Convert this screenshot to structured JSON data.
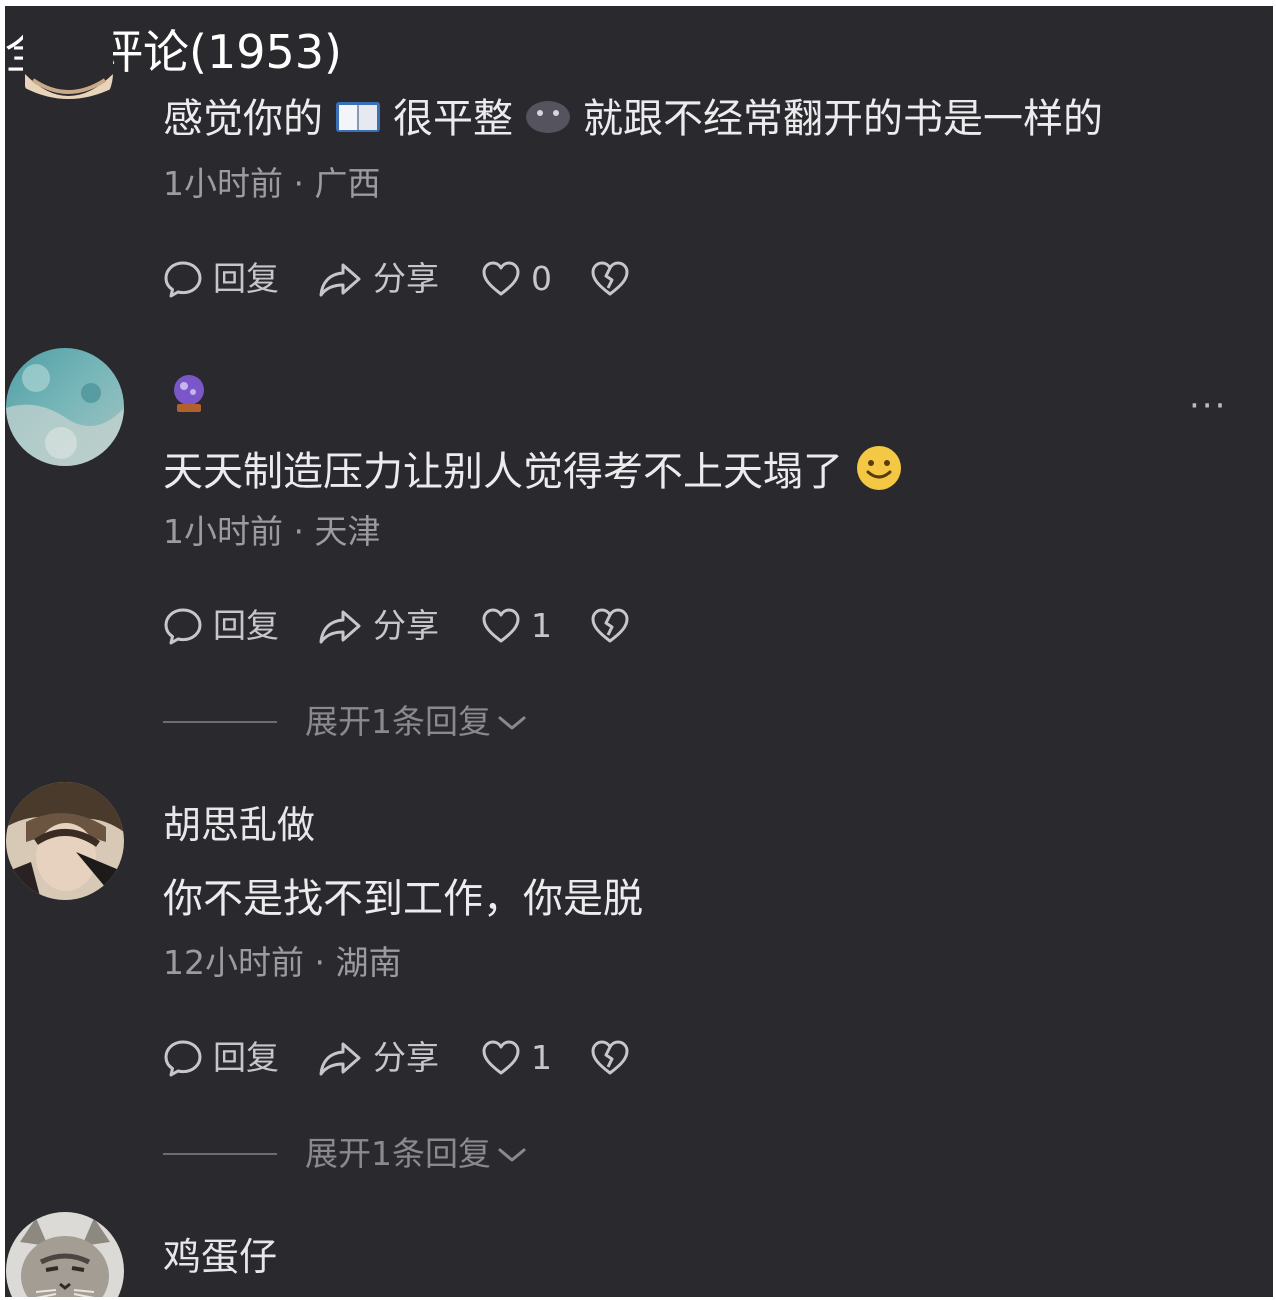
{
  "header": {
    "title": "全部评论(1953)"
  },
  "comments": [
    {
      "text_parts": [
        "感觉你的",
        "很平整",
        "就跟不经常翻开的书是一样的"
      ],
      "emoji": [
        "book-emoji",
        "alien-monster-emoji"
      ],
      "meta": "1小时前 · 广西",
      "reply_label": "回复",
      "share_label": "分享",
      "like_count": "0"
    },
    {
      "username_icon": "crystal-ball-emoji",
      "text": "天天制造压力让别人觉得考不上天塌了",
      "emoji": [
        "smiley-emoji"
      ],
      "meta": "1小时前 · 天津",
      "reply_label": "回复",
      "share_label": "分享",
      "like_count": "1",
      "expand_label": "展开1条回复",
      "more_label": "···"
    },
    {
      "username": "胡思乱做",
      "text": "你不是找不到工作，你是脱",
      "meta": "12小时前 · 湖南",
      "reply_label": "回复",
      "share_label": "分享",
      "like_count": "1",
      "expand_label": "展开1条回复"
    },
    {
      "username": "鸡蛋仔"
    }
  ],
  "colors": {
    "background": "#2a292d",
    "text_primary": "#ececee",
    "text_secondary": "#9c9ba1",
    "icon": "#c7c6cb"
  }
}
